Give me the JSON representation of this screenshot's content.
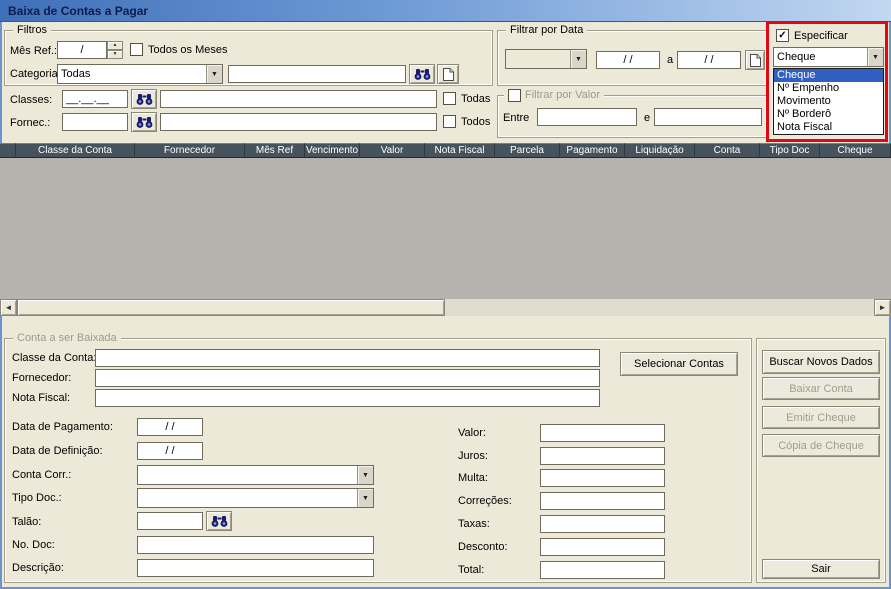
{
  "titlebar": {
    "title": "Baixa de Contas a Pagar"
  },
  "filtros": {
    "legend": "Filtros",
    "mes_ref": {
      "label": "Mês Ref.:",
      "value": "/"
    },
    "todos_meses": "Todos os Meses",
    "categoria": {
      "label": "Categoria:",
      "value": "Todas",
      "search": ""
    },
    "classes": {
      "label": "Classes:",
      "mask": "__.__.__",
      "search": "",
      "todas": "Todas"
    },
    "fornec": {
      "label": "Fornec.:",
      "value": "",
      "search": "",
      "todos": "Todos"
    }
  },
  "filtrar_data": {
    "legend": "Filtrar por Data",
    "combo_value": "",
    "from": "/ /",
    "conj": "a",
    "to": "/ /"
  },
  "filtrar_valor": {
    "legend": "Filtrar por Valor",
    "entre": "Entre",
    "from": "",
    "conj": "e",
    "to": ""
  },
  "especificar": {
    "label": "Especificar",
    "value": "Cheque",
    "options": [
      "Cheque",
      "Nº Empenho",
      "Movimento",
      "Nº Borderô",
      "Nota Fiscal"
    ]
  },
  "grid": {
    "columns": [
      "",
      "Classe da Conta",
      "Fornecedor",
      "Mês Ref",
      "Vencimento",
      "Valor",
      "Nota Fiscal",
      "Parcela",
      "Pagamento",
      "Liquidação",
      "Conta",
      "Tipo Doc",
      "Cheque"
    ]
  },
  "conta": {
    "legend": "Conta a ser Baixada",
    "classe_conta": {
      "label": "Classe da Conta:",
      "value": ""
    },
    "fornecedor": {
      "label": "Fornecedor:",
      "value": ""
    },
    "nota_fiscal": {
      "label": "Nota Fiscal:",
      "value": ""
    },
    "selecionar_contas": "Selecionar Contas",
    "data_pagamento": {
      "label": "Data de Pagamento:",
      "value": "/ /"
    },
    "data_definicao": {
      "label": "Data de Definição:",
      "value": "/ /"
    },
    "conta_corr": {
      "label": "Conta Corr.:",
      "value": ""
    },
    "tipo_doc": {
      "label": "Tipo Doc.:",
      "value": ""
    },
    "talao": {
      "label": "Talão:",
      "value": ""
    },
    "no_doc": {
      "label": "No. Doc:",
      "value": ""
    },
    "descricao": {
      "label": "Descrição:",
      "value": ""
    },
    "valor": {
      "label": "Valor:",
      "value": ""
    },
    "juros": {
      "label": "Juros:",
      "value": ""
    },
    "multa": {
      "label": "Multa:",
      "value": ""
    },
    "correcoes": {
      "label": "Correções:",
      "value": ""
    },
    "taxas": {
      "label": "Taxas:",
      "value": ""
    },
    "desconto": {
      "label": "Desconto:",
      "value": ""
    },
    "total": {
      "label": "Total:",
      "value": ""
    }
  },
  "actions": {
    "buscar": "Buscar Novos Dados",
    "baixar": "Baixar Conta",
    "emitir": "Emitir Cheque",
    "copia": "Cópia de Cheque",
    "sair": "Sair"
  }
}
